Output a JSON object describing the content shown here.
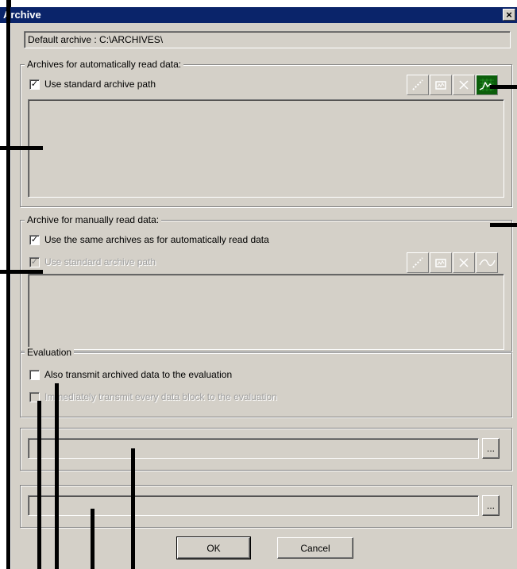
{
  "window": {
    "title": "Archive",
    "close_label": "×"
  },
  "default_archive": "Default archive : C:\\ARCHIVES\\",
  "auto_group": {
    "legend": "Archives for automatically read data:",
    "use_standard_path_label": "Use standard archive path",
    "use_standard_path_checked": true,
    "toolbar_icons": [
      "dotted-line-icon",
      "chart-icon",
      "cross-icon",
      "waveform-icon"
    ]
  },
  "manual_group": {
    "legend": "Archive for manually read data:",
    "same_archives_label": "Use the same archives as for automatically read data",
    "same_archives_checked": true,
    "use_standard_path_label": "Use standard archive path",
    "use_standard_path_checked": true,
    "toolbar_icons": [
      "dotted-line-icon",
      "chart-icon",
      "cross-icon",
      "waveform-icon"
    ]
  },
  "evaluation_group": {
    "legend": "Evaluation",
    "transmit_label": "Also transmit archived data to the evaluation",
    "transmit_checked": false,
    "immediate_label": "Immediately transmit every data block to the evaluation",
    "immediate_checked": false
  },
  "path_fields": [
    {
      "value": "",
      "browse_label": "..."
    },
    {
      "value": "",
      "browse_label": "..."
    }
  ],
  "buttons": {
    "ok": "OK",
    "cancel": "Cancel"
  },
  "colors": {
    "titlebar": "#0a246a",
    "dialog": "#d4d0c8",
    "active_icon": "#0b5e0b"
  }
}
